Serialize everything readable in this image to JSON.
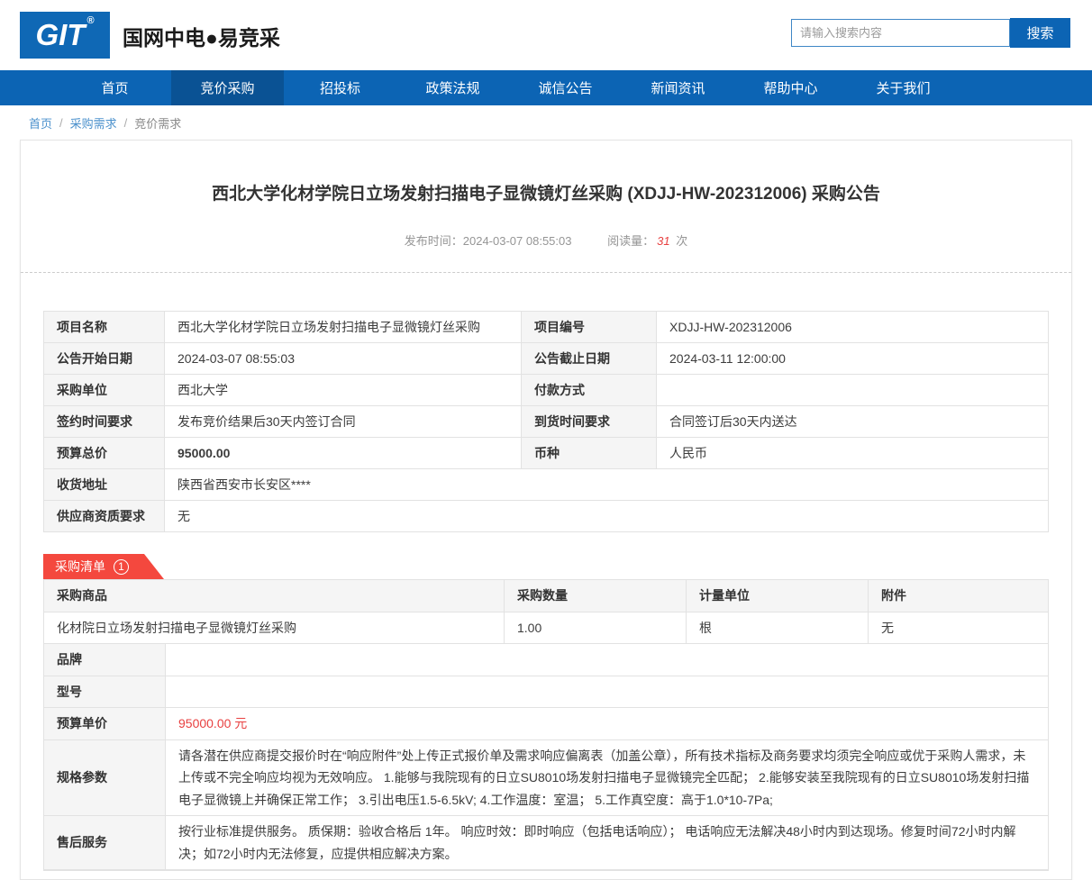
{
  "header": {
    "logo_text": "GIT",
    "logo_reg": "®",
    "site_name": "国网中电●易竞采",
    "search": {
      "placeholder": "请输入搜索内容",
      "button_label": "搜索"
    }
  },
  "nav": {
    "items": [
      {
        "label": "首页"
      },
      {
        "label": "竞价采购"
      },
      {
        "label": "招投标"
      },
      {
        "label": "政策法规"
      },
      {
        "label": "诚信公告"
      },
      {
        "label": "新闻资讯"
      },
      {
        "label": "帮助中心"
      },
      {
        "label": "关于我们"
      }
    ],
    "active_index": 1
  },
  "breadcrumb": {
    "items": [
      "首页",
      "采购需求",
      "竞价需求"
    ],
    "separator": "/"
  },
  "announcement": {
    "title": "西北大学化材学院日立场发射扫描电子显微镜灯丝采购 (XDJJ-HW-202312006) 采购公告",
    "publish_label": "发布时间：",
    "publish_time": "2024-03-07 08:55:03",
    "views_label": "阅读量：",
    "views_count": "31",
    "views_unit": "次"
  },
  "info_table": {
    "rows": [
      {
        "l1": "项目名称",
        "v1": "西北大学化材学院日立场发射扫描电子显微镜灯丝采购",
        "l2": "项目编号",
        "v2": "XDJJ-HW-202312006"
      },
      {
        "l1": "公告开始日期",
        "v1": "2024-03-07 08:55:03",
        "l2": "公告截止日期",
        "v2": "2024-03-11 12:00:00"
      },
      {
        "l1": "采购单位",
        "v1": "西北大学",
        "l2": "付款方式",
        "v2": ""
      },
      {
        "l1": "签约时间要求",
        "v1": "发布竞价结果后30天内签订合同",
        "l2": "到货时间要求",
        "v2": "合同签订后30天内送达"
      },
      {
        "l1": "预算总价",
        "v1": "95000.00",
        "l2": "币种",
        "v2": "人民币"
      },
      {
        "l1": "收货地址",
        "v1": "陕西省西安市长安区****"
      },
      {
        "l1": "供应商资质要求",
        "v1": "无"
      }
    ]
  },
  "purchase_list": {
    "badge_label": "采购清单",
    "badge_count": "1",
    "headers": [
      "采购商品",
      "采购数量",
      "计量单位",
      "附件"
    ],
    "product_row": {
      "name": "化材院日立场发射扫描电子显微镜灯丝采购",
      "quantity": "1.00",
      "unit": "根",
      "attachment": "无"
    },
    "detail_rows": [
      {
        "label": "品牌",
        "value": ""
      },
      {
        "label": "型号",
        "value": ""
      },
      {
        "label": "预算单价",
        "value": "95000.00 元"
      },
      {
        "label": "规格参数",
        "value": "请各潜在供应商提交报价时在“响应附件”处上传正式报价单及需求响应偏离表（加盖公章），所有技术指标及商务要求均须完全响应或优于采购人需求，未上传或不完全响应均视为无效响应。 1.能够与我院现有的日立SU8010场发射扫描电子显微镜完全匹配； 2.能够安装至我院现有的日立SU8010场发射扫描电子显微镜上并确保正常工作； 3.引出电压1.5-6.5kV; 4.工作温度：室温； 5.工作真空度：高于1.0*10-7Pa;"
      },
      {
        "label": "售后服务",
        "value": "按行业标准提供服务。 质保期：验收合格后 1年。 响应时效：即时响应（包括电话响应）； 电话响应无法解决48小时内到达现场。修复时间72小时内解决；如72小时内无法修复，应提供相应解决方案。"
      }
    ]
  },
  "colors": {
    "primary_blue": "#0c64b4",
    "active_blue": "#0a5294",
    "badge_red": "#f4483e",
    "price_red": "#e84040"
  }
}
